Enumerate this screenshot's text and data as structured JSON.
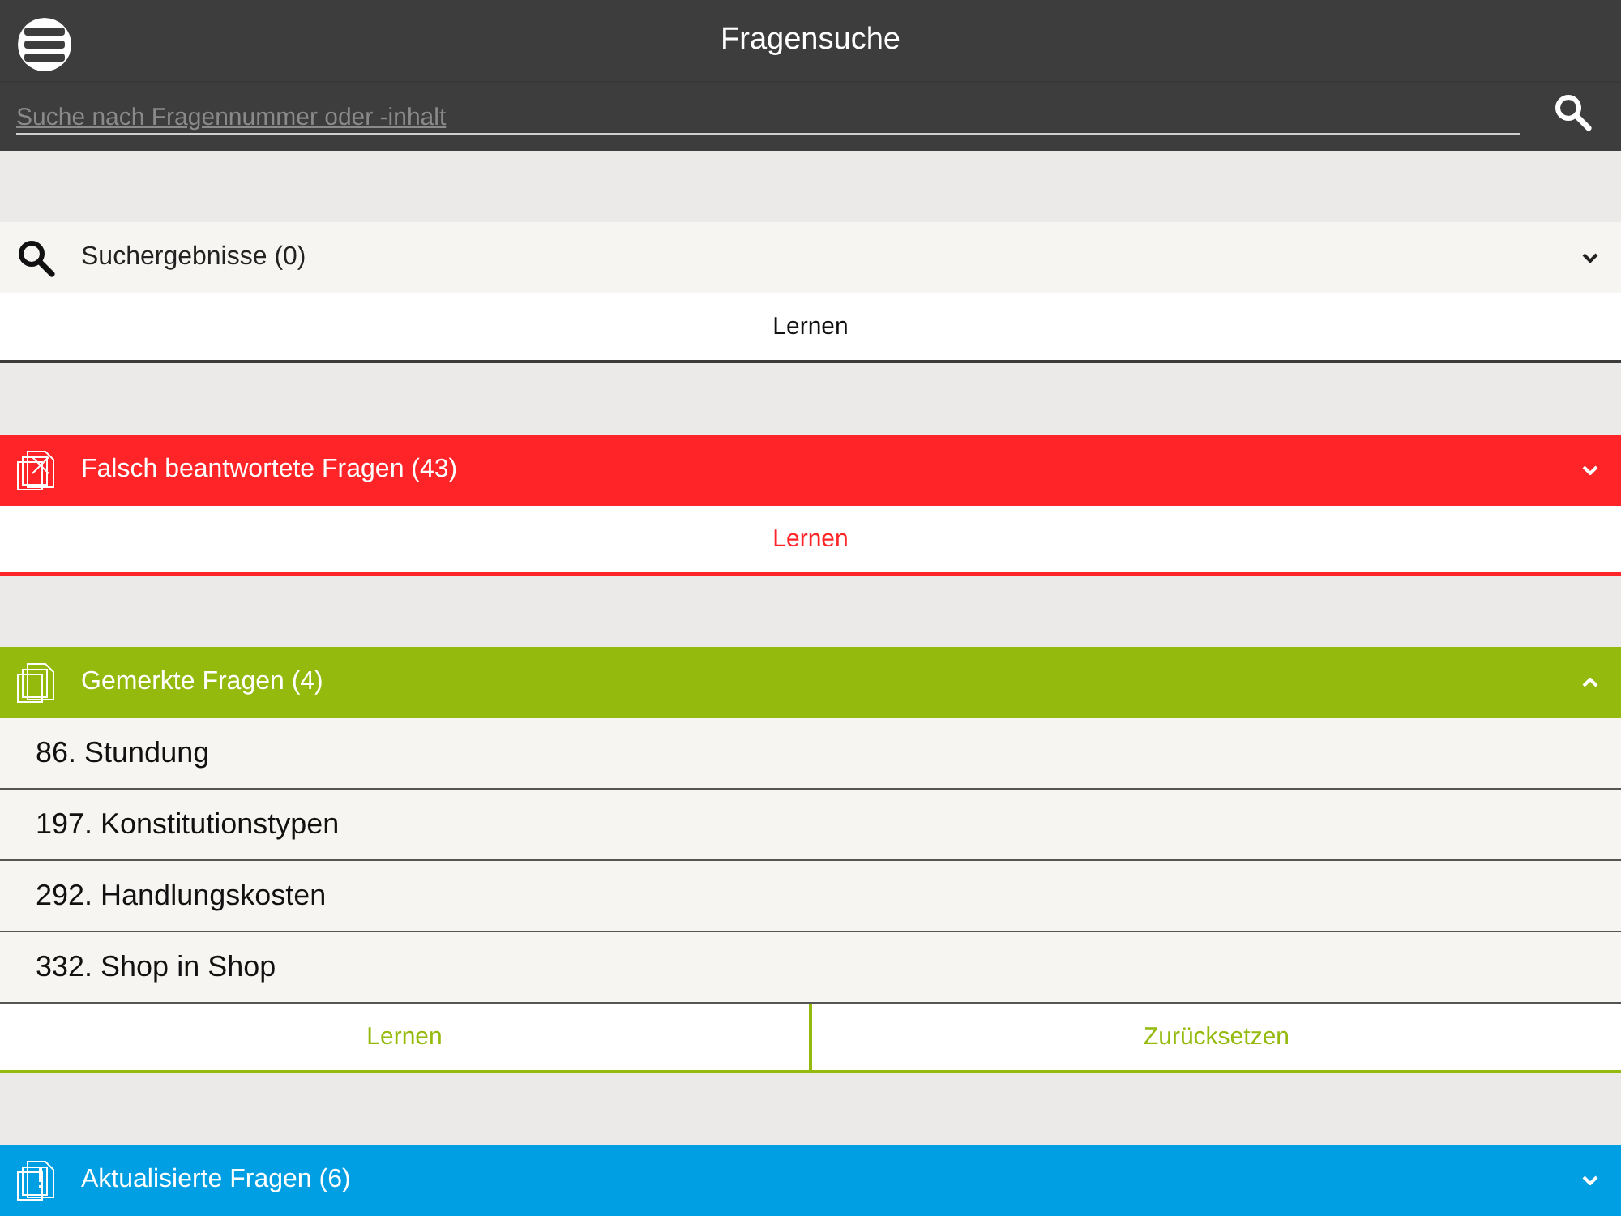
{
  "app_bar": {
    "title": "Fragensuche"
  },
  "search": {
    "placeholder": "Suche nach Fragennummer oder -inhalt"
  },
  "sections": [
    {
      "kind": "search",
      "title": "Suchergebnisse (0)",
      "color": "#3c3c3c",
      "expanded": false,
      "buttons": [
        "Lernen"
      ]
    },
    {
      "kind": "wrong",
      "title": "Falsch beantwortete Fragen (43)",
      "color": "#ff2427",
      "expanded": false,
      "buttons": [
        "Lernen"
      ]
    },
    {
      "kind": "marked",
      "title": "Gemerkte Fragen (4)",
      "color": "#95ba0e",
      "expanded": true,
      "items": [
        "86. Stundung",
        "197. Konstitutionstypen",
        "292. Handlungskosten",
        "332. Shop in Shop"
      ],
      "buttons": [
        "Lernen",
        "Zurücksetzen"
      ]
    },
    {
      "kind": "updated",
      "title": "Aktualisierte Fragen (6)",
      "color": "#009fe3",
      "expanded": false
    }
  ]
}
